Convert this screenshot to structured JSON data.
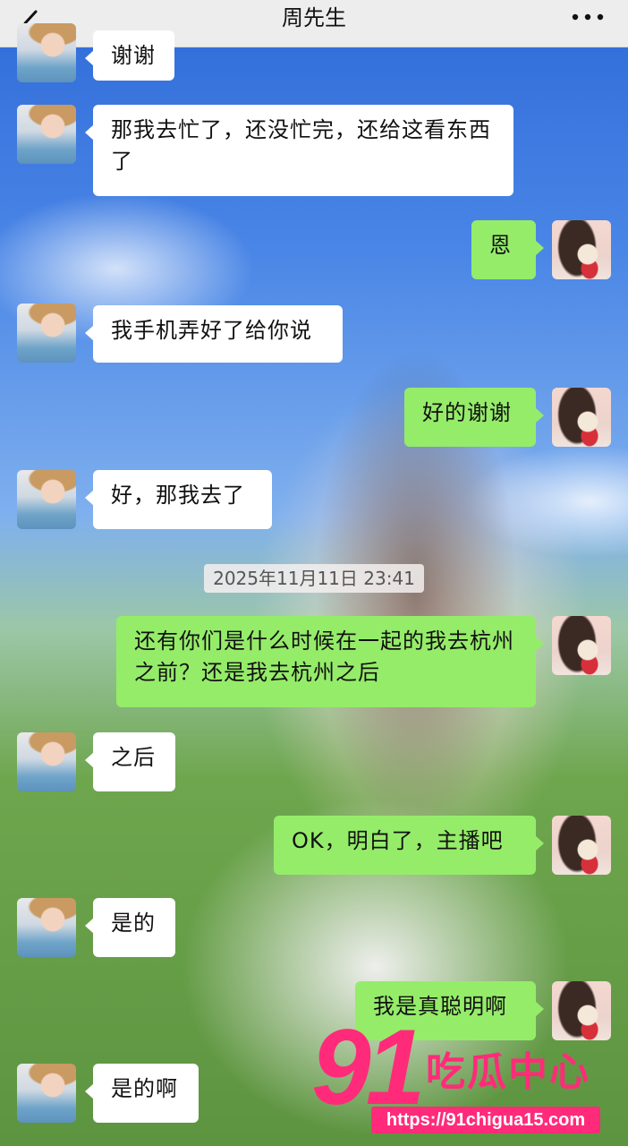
{
  "header": {
    "title": "周先生",
    "back_icon": "chevron-left-icon",
    "more_icon": "more-dots-icon"
  },
  "messages": [
    {
      "side": "left",
      "text": "谢谢"
    },
    {
      "side": "left",
      "text": "那我去忙了，还没忙完，还给这看东西了"
    },
    {
      "side": "right",
      "text": "恩"
    },
    {
      "side": "left",
      "text": "我手机弄好了给你说"
    },
    {
      "side": "right",
      "text": "好的谢谢"
    },
    {
      "side": "left",
      "text": "好，那我去了"
    },
    {
      "side": "right",
      "text": "还有你们是什么时候在一起的我去杭州之前？还是我去杭州之后"
    },
    {
      "side": "left",
      "text": "之后"
    },
    {
      "side": "right",
      "text": "OK，明白了，主播吧"
    },
    {
      "side": "left",
      "text": "是的"
    },
    {
      "side": "right",
      "text": "我是真聪明啊"
    },
    {
      "side": "left",
      "text": "是的啊"
    }
  ],
  "timestamp": "2025年11月11日 23:41",
  "watermark": {
    "number": "91",
    "text": "吃瓜中心",
    "url": "https://91chigua15.com",
    "color": "#ff2b7a"
  },
  "colors": {
    "bubble_self": "#95ec69",
    "bubble_other": "#ffffff",
    "topbar": "#ededed"
  }
}
